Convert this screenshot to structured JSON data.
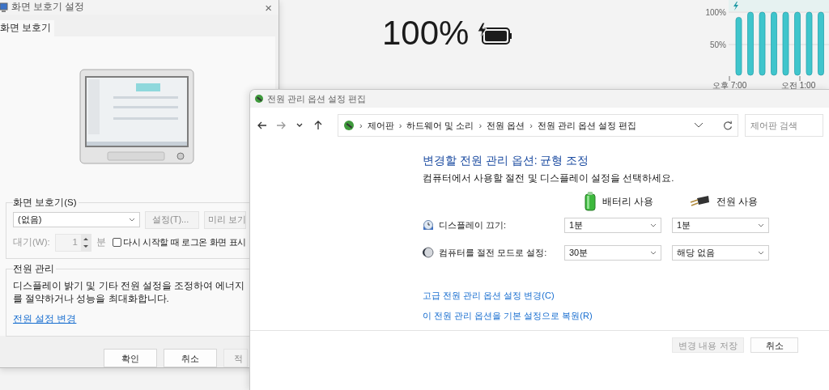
{
  "background_app": {
    "battery_percent": "100%",
    "charging": true,
    "chart": {
      "y_labels": [
        "100%",
        "50%"
      ],
      "x_labels": [
        "오후 7:00",
        "오전 1:00"
      ]
    }
  },
  "screensaver_dialog": {
    "title": "화면 보호기 설정",
    "close": "×",
    "tabs": [
      {
        "label": "화면 보호기",
        "selected": true
      }
    ],
    "screensaver_group": {
      "legend": "화면 보호기(S)",
      "dropdown": "(없음)",
      "buttons": [
        {
          "label": "설정(T)...",
          "disabled": true
        },
        {
          "label": "미리 보기",
          "disabled": true
        }
      ],
      "wait_label": "대기(W):",
      "wait_value": "1",
      "wait_unit": "분",
      "wait_disabled": true,
      "logon_checkbox": {
        "label": "다시 시작할 때 로그온 화면 표시",
        "checked": false
      }
    },
    "power_group": {
      "legend": "전원 관리",
      "description": "디스플레이 밝기 및 기타 전원 설정을 조정하여 에너지를 절약하거나 성능을 최대화합니다.",
      "link": "전원 설정 변경"
    },
    "buttons": [
      {
        "label": "확인",
        "disabled": false
      },
      {
        "label": "취소",
        "disabled": false
      },
      {
        "label": "적",
        "disabled": true
      }
    ]
  },
  "power_window": {
    "title": "전원 관리 옵션 설정 편집",
    "breadcrumbs": [
      {
        "separator": "›",
        "label": "제어판"
      },
      {
        "separator": "›",
        "label": "하드웨어 및 소리"
      },
      {
        "separator": "›",
        "label": "전원 옵션"
      },
      {
        "separator": "›",
        "label": "전원 관리 옵션 설정 편집"
      }
    ],
    "search": {
      "placeholder": "제어판 검색"
    },
    "heading": "변경할 전원 관리 옵션: 균형 조정",
    "subheading": "컴퓨터에서 사용할 절전 및 디스플레이 설정을 선택하세요.",
    "columns": [
      {
        "kind": "battery",
        "label": "배터리 사용"
      },
      {
        "kind": "plug",
        "label": "전원 사용"
      }
    ],
    "rows": [
      {
        "kind": "display",
        "label": "디스플레이 끄기:",
        "battery": "1분",
        "plugged": "1분"
      },
      {
        "kind": "sleep",
        "label": "컴퓨터를 절전 모드로 설정:",
        "battery": "30분",
        "plugged": "해당 없음"
      }
    ],
    "links": [
      "고급 전원 관리 옵션 설정 변경(C)",
      "이 전원 관리 옵션을 기본 설정으로 복원(R)"
    ],
    "buttons": [
      {
        "label": "변경 내용 저장",
        "disabled": true
      },
      {
        "label": "취소",
        "disabled": false
      }
    ]
  }
}
